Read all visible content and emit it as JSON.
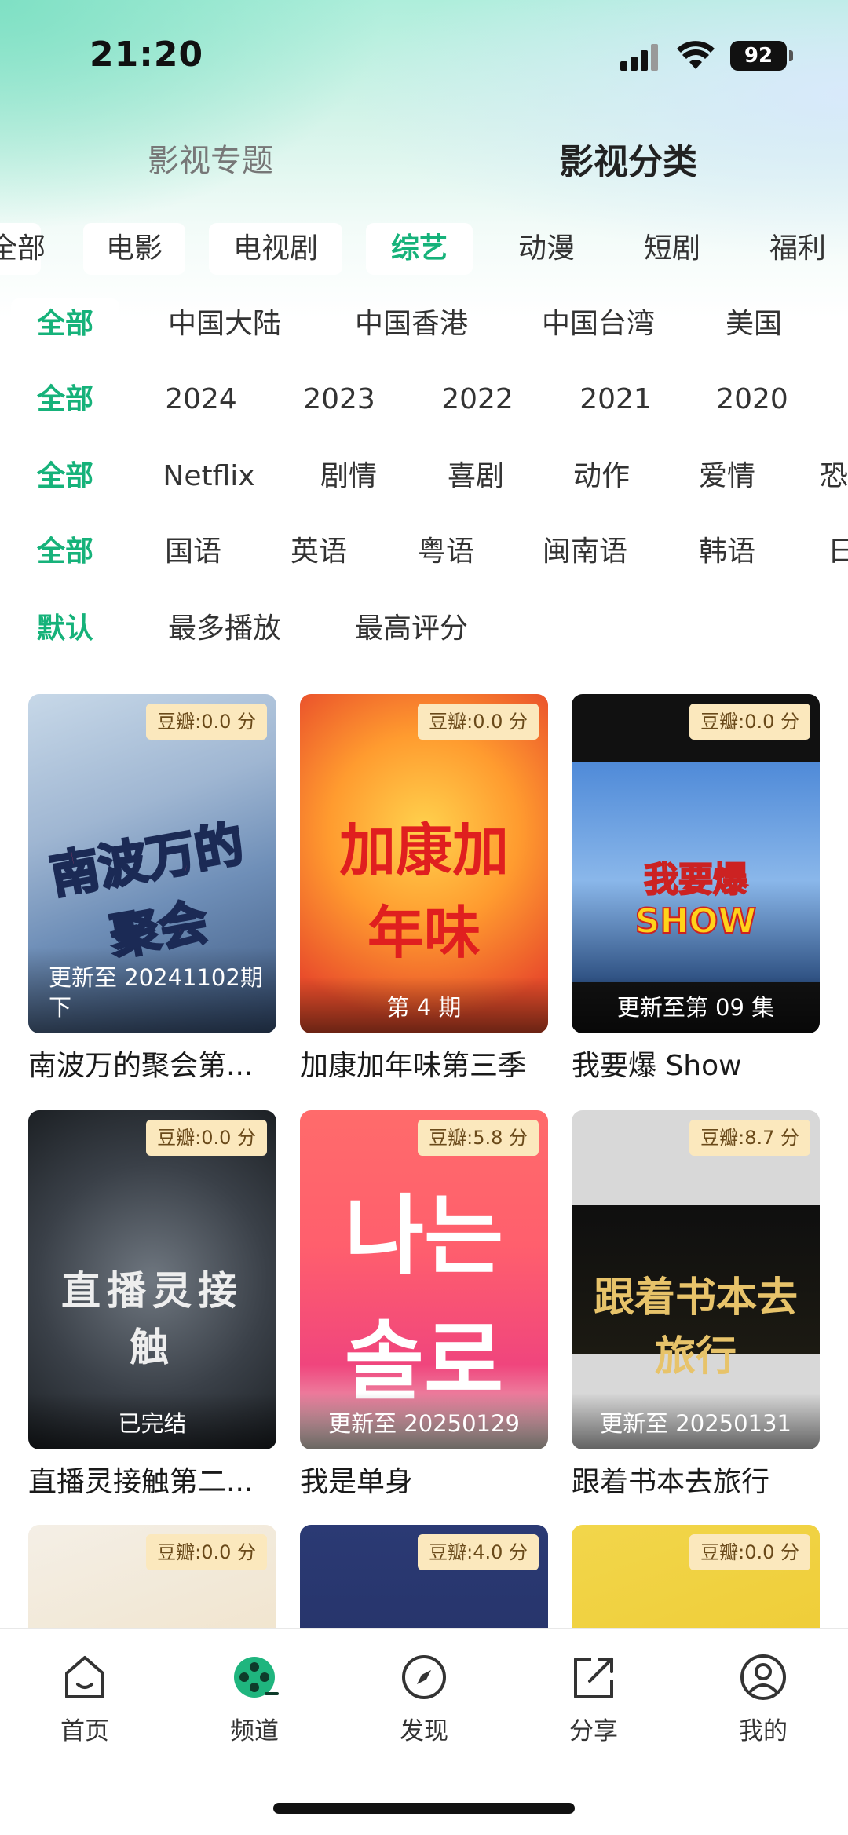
{
  "status_bar": {
    "time": "21:20",
    "battery": "92"
  },
  "header": {
    "tab_topics": "影视专题",
    "tab_categories": "影视分类"
  },
  "filters": {
    "type_row": [
      "全部",
      "电影",
      "电视剧",
      "综艺",
      "动漫",
      "短剧",
      "福利"
    ],
    "region_row": [
      "全部",
      "中国大陆",
      "中国香港",
      "中国台湾",
      "美国"
    ],
    "year_row": [
      "全部",
      "2024",
      "2023",
      "2022",
      "2021",
      "2020"
    ],
    "genre_row": [
      "全部",
      "Netflix",
      "剧情",
      "喜剧",
      "动作",
      "爱情",
      "恐"
    ],
    "language_row": [
      "全部",
      "国语",
      "英语",
      "粤语",
      "闽南语",
      "韩语",
      "日"
    ],
    "sort_row": [
      "默认",
      "最多播放",
      "最高评分"
    ]
  },
  "cards": [
    {
      "title": "南波万的聚会第...",
      "rating": "豆瓣:0.0 分",
      "update": "更新至 20241102期下",
      "art_text": "南波万的聚会"
    },
    {
      "title": "加康加年味第三季",
      "rating": "豆瓣:0.0 分",
      "update": "第 4 期",
      "art_text": "加康加年味"
    },
    {
      "title": "我要爆 Show",
      "rating": "豆瓣:0.0 分",
      "update": "更新至第 09 集",
      "art_text": "我要爆SHOW"
    },
    {
      "title": "直播灵接触第二...",
      "rating": "豆瓣:0.0 分",
      "update": "已完结",
      "art_text": "直播灵接触"
    },
    {
      "title": "我是单身",
      "rating": "豆瓣:5.8 分",
      "update": "更新至 20250129",
      "art_text": "나는솔로"
    },
    {
      "title": "跟着书本去旅行",
      "rating": "豆瓣:8.7 分",
      "update": "更新至 20250131",
      "art_text": "跟着书本去旅行"
    },
    {
      "title": "",
      "rating": "豆瓣:0.0 分",
      "update": "",
      "art_text": ""
    },
    {
      "title": "",
      "rating": "豆瓣:4.0 分",
      "update": "",
      "art_text": ""
    },
    {
      "title": "",
      "rating": "豆瓣:0.0 分",
      "update": "",
      "art_text": ""
    }
  ],
  "bottom_nav": [
    {
      "label": "首页",
      "icon": "home-icon"
    },
    {
      "label": "频道",
      "icon": "film-reel-icon"
    },
    {
      "label": "发现",
      "icon": "compass-icon"
    },
    {
      "label": "分享",
      "icon": "share-icon"
    },
    {
      "label": "我的",
      "icon": "profile-icon"
    }
  ],
  "colors": {
    "accent": "#16b27a",
    "badge_bg": "#fbe8bd"
  }
}
